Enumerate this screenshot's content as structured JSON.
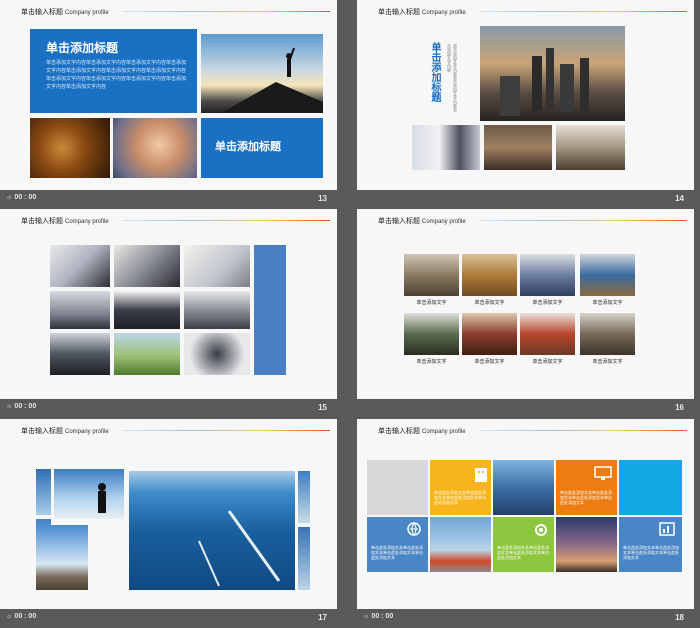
{
  "header": {
    "title": "单击输入标题",
    "subtitle": "Company  profile"
  },
  "footer": {
    "time": "00 : 00"
  },
  "slides": [
    {
      "num": "13",
      "title_a": "单击添加标题",
      "body_a": "单击添加文字内容单击添加文字内容单击添加文字内容单击添加文字内容单击添加文字内容单击添加文字内容单击添加文字内容单击添加文字内容单击添加文字内容单击添加文字内容单击添加文字内容单击添加文字内容",
      "title_b": "单击添加标题"
    },
    {
      "num": "14",
      "vertical_title": "单击添加标题",
      "vertical_text": "单击添加文字内容单击添加文字内容单击添加文字内容"
    },
    {
      "num": "15"
    },
    {
      "num": "16",
      "captions": [
        "单击添加文字",
        "单击添加文字",
        "单击添加文字",
        "单击添加文字",
        "单击添加文字",
        "单击添加文字",
        "单击添加文字",
        "单击添加文字"
      ]
    },
    {
      "num": "17"
    },
    {
      "num": "18",
      "tile_text": "单击此处添加文本单击此处添加文本单击此处添加文本单击此处添加文本"
    }
  ],
  "colors": {
    "blue": "#1a70c3",
    "yellow": "#f7b41d",
    "orange": "#ed7d12",
    "green": "#8dc63f",
    "cyan": "#12a9e6",
    "mid_blue": "#4a86c6"
  }
}
